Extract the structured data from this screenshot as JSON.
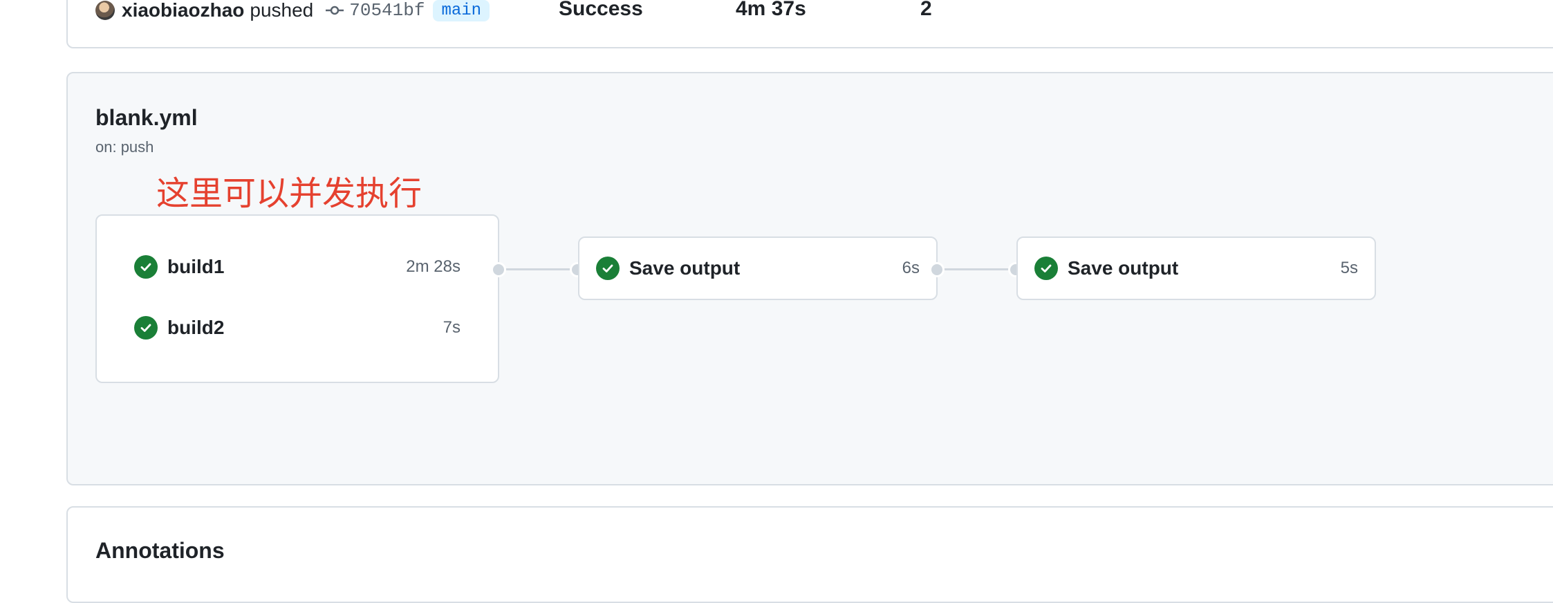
{
  "summary": {
    "actor": "xiaobiaozhao",
    "action": "pushed",
    "commit_sha": "70541bf",
    "branch": "main",
    "status": "Success",
    "duration": "4m 37s",
    "artifacts": "2"
  },
  "workflow": {
    "file": "blank.yml",
    "trigger": "on: push",
    "annotation_note": "这里可以并发执行",
    "jobs_group_1": [
      {
        "name": "build1",
        "duration": "2m 28s",
        "status": "success"
      },
      {
        "name": "build2",
        "duration": "7s",
        "status": "success"
      }
    ],
    "job_2": {
      "name": "Save output",
      "duration": "6s",
      "status": "success"
    },
    "job_3": {
      "name": "Save output",
      "duration": "5s",
      "status": "success"
    }
  },
  "annotations": {
    "title": "Annotations"
  },
  "colors": {
    "success": "#1a7f37",
    "annotation_text": "#e5412f",
    "branch_bg": "#ddf4ff",
    "branch_text": "#0969da"
  },
  "icons": [
    "avatar",
    "git-commit-icon",
    "check-circle-icon"
  ]
}
